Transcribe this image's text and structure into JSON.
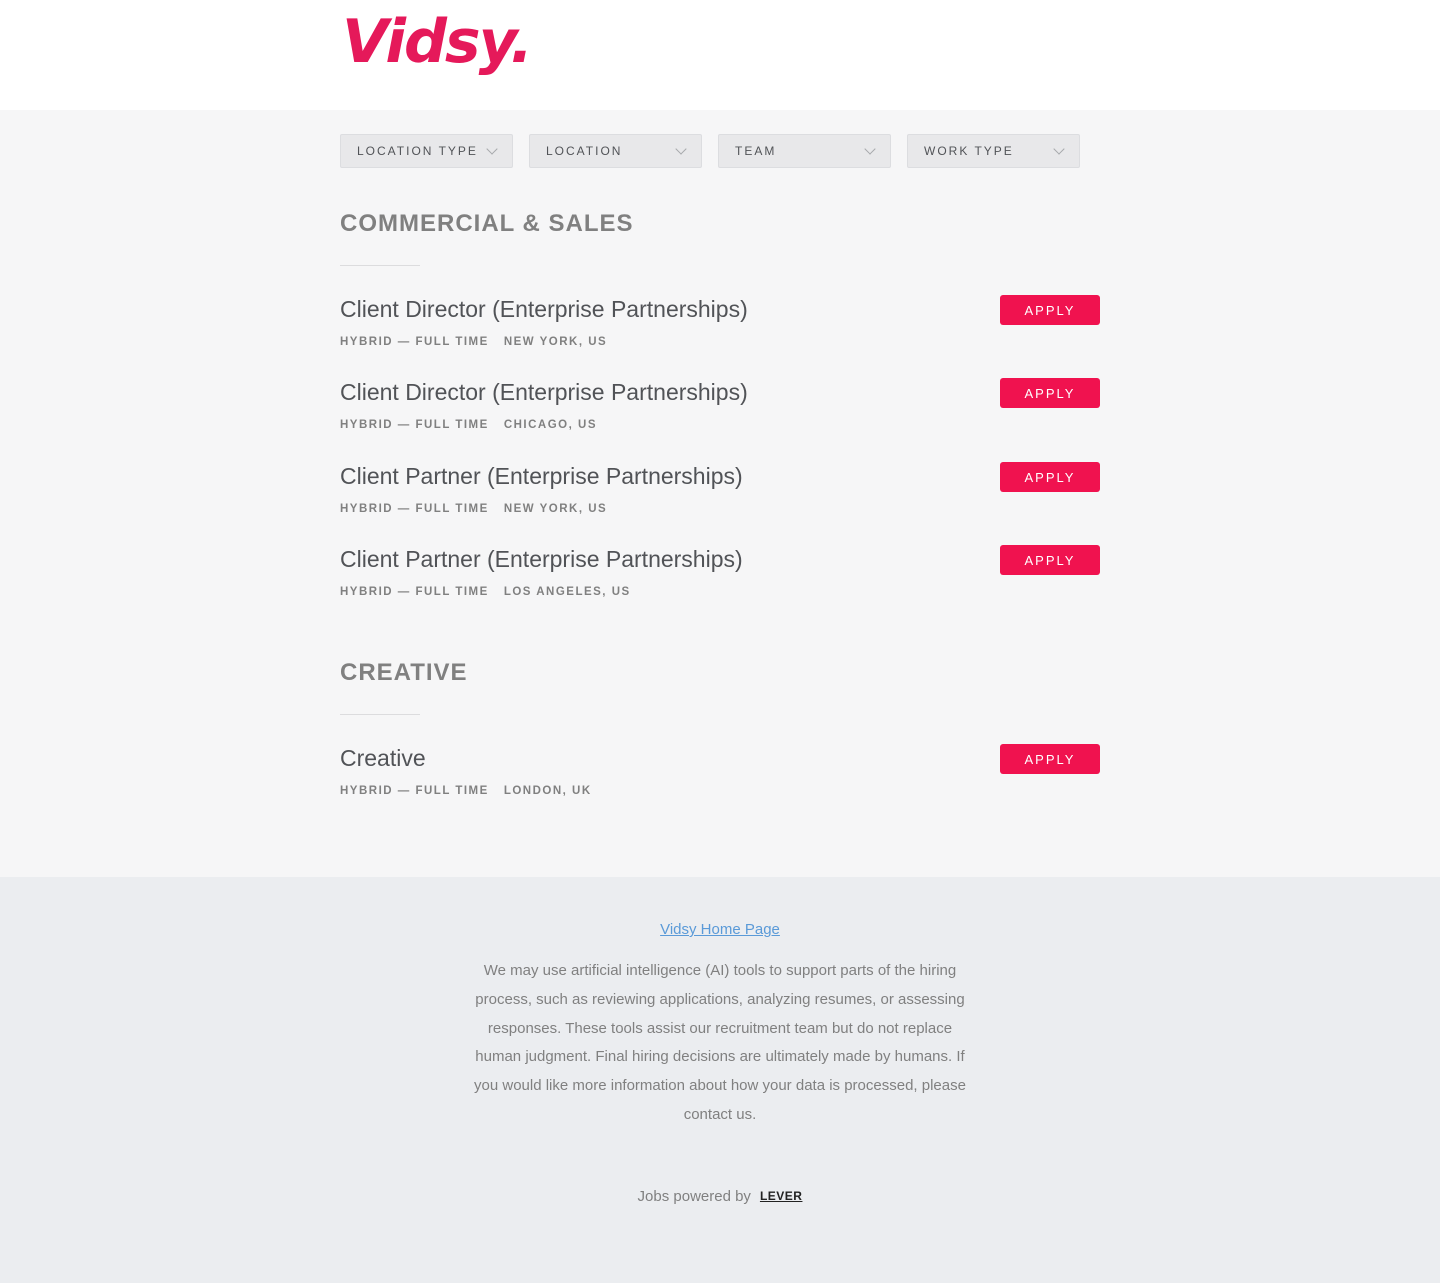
{
  "brand": {
    "logo_text": "Vidsy.",
    "color": "#e5195a"
  },
  "filters": [
    {
      "label": "LOCATION TYPE"
    },
    {
      "label": "LOCATION"
    },
    {
      "label": "TEAM"
    },
    {
      "label": "WORK TYPE"
    }
  ],
  "sections": [
    {
      "title": "COMMERCIAL & SALES",
      "postings": [
        {
          "title": "Client Director (Enterprise Partnerships)",
          "work_type": "HYBRID — FULL TIME",
          "location": "NEW YORK, US",
          "apply_label": "APPLY"
        },
        {
          "title": "Client Director (Enterprise Partnerships)",
          "work_type": "HYBRID — FULL TIME",
          "location": "CHICAGO, US",
          "apply_label": "APPLY"
        },
        {
          "title": "Client Partner (Enterprise Partnerships)",
          "work_type": "HYBRID — FULL TIME",
          "location": "NEW YORK, US",
          "apply_label": "APPLY"
        },
        {
          "title": "Client Partner (Enterprise Partnerships)",
          "work_type": "HYBRID — FULL TIME",
          "location": "LOS ANGELES, US",
          "apply_label": "APPLY"
        }
      ]
    },
    {
      "title": "CREATIVE",
      "postings": [
        {
          "title": "Creative",
          "work_type": "HYBRID — FULL TIME",
          "location": "LONDON, UK",
          "apply_label": "APPLY"
        }
      ]
    }
  ],
  "footer": {
    "home_link": "Vidsy Home Page",
    "disclaimer": "We may use artificial intelligence (AI) tools to support parts of the hiring process, such as reviewing applications, analyzing resumes, or assessing responses. These tools assist our recruitment team but do not replace human judgment. Final hiring decisions are ultimately made by humans. If you would like more information about how your data is processed, please contact us.",
    "powered_by": "Jobs powered by",
    "powered_brand": "LEVER"
  },
  "colors": {
    "accent": "#f0124f",
    "link": "#5a9ad8"
  }
}
